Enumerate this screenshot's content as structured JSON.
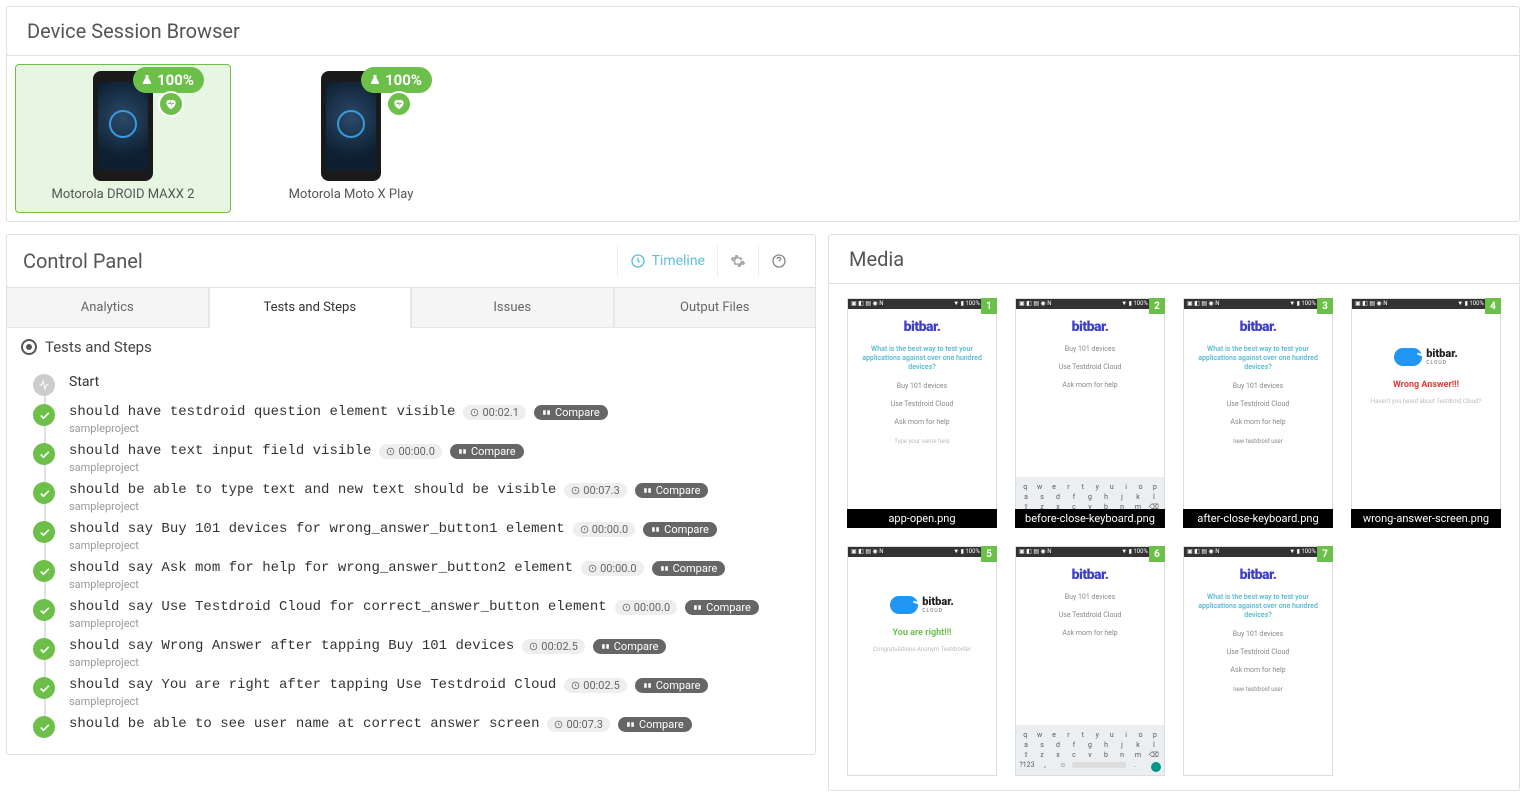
{
  "deviceBrowser": {
    "title": "Device Session Browser",
    "devices": [
      {
        "name": "Motorola DROID MAXX 2",
        "score": "100%",
        "selected": true
      },
      {
        "name": "Motorola Moto X Play",
        "score": "100%",
        "selected": false
      }
    ]
  },
  "controlPanel": {
    "title": "Control Panel",
    "timelineLabel": "Timeline",
    "tabs": [
      "Analytics",
      "Tests and Steps",
      "Issues",
      "Output Files"
    ],
    "activeTab": 1,
    "sectionTitle": "Tests and Steps",
    "startLabel": "Start",
    "compareLabel": "Compare",
    "steps": [
      {
        "title": "should have testdroid question element visible",
        "time": "00:02.1",
        "project": "sampleproject"
      },
      {
        "title": "should have text input field visible",
        "time": "00:00.0",
        "project": "sampleproject"
      },
      {
        "title": "should be able to type text and new text should be visible",
        "time": "00:07.3",
        "project": "sampleproject"
      },
      {
        "title": "should say Buy 101 devices for wrong_answer_button1 element",
        "time": "00:00.0",
        "project": "sampleproject"
      },
      {
        "title": "should say Ask mom for help for wrong_answer_button2 element",
        "time": "00:00.0",
        "project": "sampleproject"
      },
      {
        "title": "should say Use Testdroid Cloud for correct_answer_button element",
        "time": "00:00.0",
        "project": "sampleproject"
      },
      {
        "title": "should say Wrong Answer after tapping Buy 101 devices",
        "time": "00:02.5",
        "project": "sampleproject"
      },
      {
        "title": "should say You are right after tapping Use Testdroid Cloud",
        "time": "00:02.5",
        "project": "sampleproject"
      },
      {
        "title": "should be able to see user name at correct answer screen",
        "time": "00:07.3",
        "project": null
      }
    ]
  },
  "media": {
    "title": "Media",
    "app": {
      "logo": "bitbar.",
      "cloudText": "bitbar.",
      "cloudSub": "CLOUD",
      "question": "What is the best way to test your applications against over one hundred devices?",
      "opt1": "Buy 101 devices",
      "opt2": "Use Testdroid Cloud",
      "opt3": "Ask mom for help",
      "typeHint": "Type your name here",
      "typedText": "new testdroid user",
      "wrong": "Wrong Answer!!!",
      "wrongSub": "Haven't you heard about Testdroid Cloud?",
      "right": "You are right!!!",
      "rightSub": "Congratulations Anonym Testdroider"
    },
    "items": [
      {
        "num": "1",
        "caption": "app-open.png",
        "variant": "question"
      },
      {
        "num": "2",
        "caption": "before-close-keyboard.png",
        "variant": "keyboard"
      },
      {
        "num": "3",
        "caption": "after-close-keyboard.png",
        "variant": "question-typed"
      },
      {
        "num": "4",
        "caption": "wrong-answer-screen.png",
        "variant": "wrong"
      },
      {
        "num": "5",
        "caption": "",
        "variant": "right"
      },
      {
        "num": "6",
        "caption": "",
        "variant": "keyboard"
      },
      {
        "num": "7",
        "caption": "",
        "variant": "question-typed"
      }
    ]
  }
}
